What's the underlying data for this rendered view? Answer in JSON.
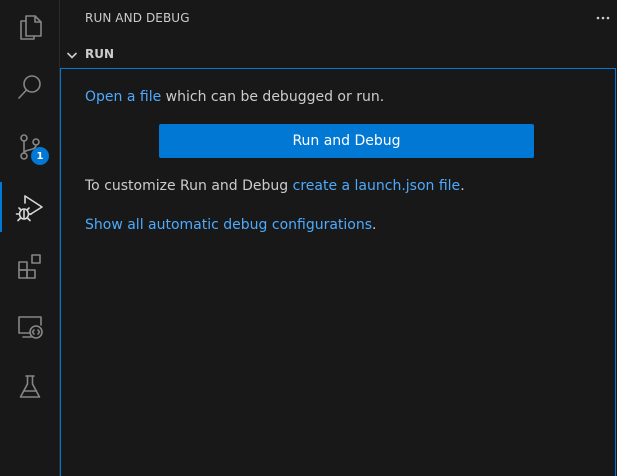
{
  "panel": {
    "title": "RUN AND DEBUG"
  },
  "section": {
    "title": "RUN"
  },
  "content": {
    "line1_link": "Open a file",
    "line1_text": " which can be debugged or run.",
    "button_label": "Run and Debug",
    "line2_text": "To customize Run and Debug ",
    "line2_link": "create a launch.json file",
    "line2_suffix": ".",
    "line3_link": "Show all automatic debug configurations",
    "line3_suffix": "."
  },
  "activity_bar": {
    "items": [
      {
        "icon": "explorer-icon"
      },
      {
        "icon": "search-icon"
      },
      {
        "icon": "source-control-icon",
        "badge": "1"
      },
      {
        "icon": "run-debug-icon",
        "active": true
      },
      {
        "icon": "extensions-icon"
      },
      {
        "icon": "remote-explorer-icon"
      },
      {
        "icon": "testing-icon"
      }
    ]
  },
  "colors": {
    "accent": "#0078d4",
    "link": "#4daafc",
    "background": "#181818",
    "text": "#cccccc"
  }
}
